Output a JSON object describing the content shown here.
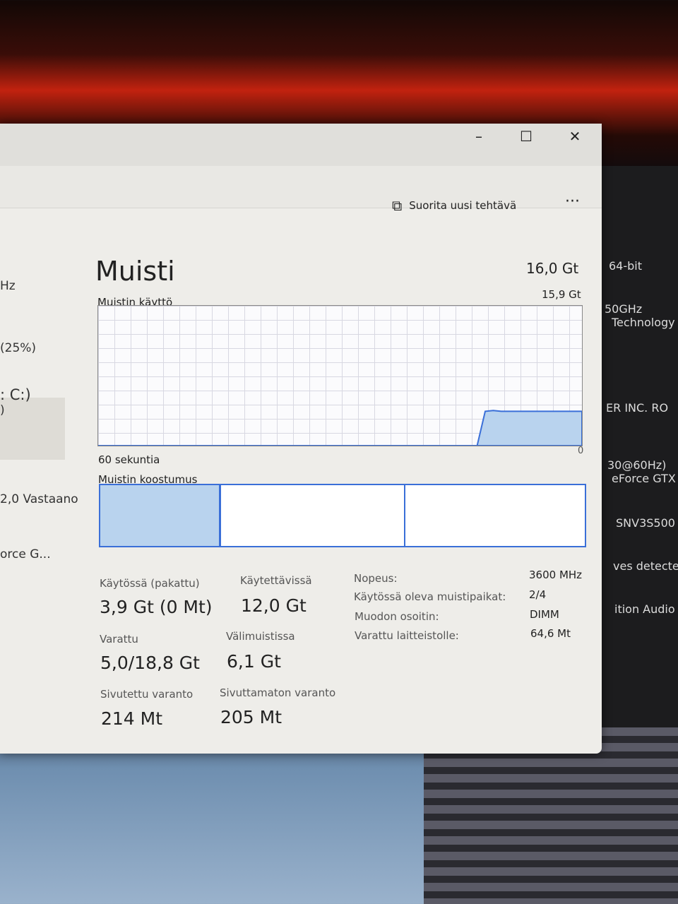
{
  "window": {
    "minimize_icon": "minimize-icon",
    "maximize_icon": "maximize-icon",
    "close_icon": "close-icon"
  },
  "toolbar": {
    "new_task_label": "Suorita uusi tehtävä",
    "more_label": "···"
  },
  "sidebar": {
    "items": [
      "Hz",
      "(25%)",
      ": C:)",
      ")",
      "2,0 Vastaano",
      "orce G..."
    ]
  },
  "right_panel": {
    "items": [
      "64-bit",
      "50GHz",
      "Technology",
      "ER INC. RO",
      "30@60Hz)",
      "eForce GTX",
      "SNV3S500",
      "ves detecte",
      "ition Audio"
    ]
  },
  "memory": {
    "title": "Muisti",
    "total": "16,0 Gt",
    "usage_label": "Muistin käyttö",
    "usage_max": "15,9 Gt",
    "time_label": "60 sekuntia",
    "min_label": "0",
    "composition_label": "Muistin koostumus",
    "composition": {
      "in_use_pct": 24.5,
      "modified_pct": 0.5,
      "standby_pct": 38,
      "free_pct": 37
    },
    "usage_series_gb": [
      0,
      0,
      0,
      0,
      0,
      0,
      0,
      0,
      0,
      0,
      0,
      0,
      0,
      0,
      0,
      0,
      0,
      0,
      0,
      0,
      0,
      0,
      0,
      0,
      0,
      0,
      0,
      0,
      0,
      0,
      0,
      0,
      0,
      0,
      0,
      0,
      0,
      0,
      0,
      0,
      0,
      0,
      0,
      0,
      0,
      0,
      0,
      0,
      3.9,
      4.0,
      3.9,
      3.9,
      3.9,
      3.9,
      3.9,
      3.9,
      3.9,
      3.9,
      3.9,
      3.9,
      3.9
    ],
    "stats": [
      {
        "label": "Käytössä (pakattu)",
        "value": "3,9 Gt (0 Mt)"
      },
      {
        "label": "Käytettävissä",
        "value": "12,0 Gt"
      },
      {
        "label": "Varattu",
        "value": "5,0/18,8 Gt"
      },
      {
        "label": "Välimuistissa",
        "value": "6,1 Gt"
      },
      {
        "label": "Sivutettu varanto",
        "value": "214 Mt"
      },
      {
        "label": "Sivuttamaton varanto",
        "value": "205 Mt"
      }
    ],
    "details": [
      {
        "label": "Nopeus:",
        "value": "3600 MHz"
      },
      {
        "label": "Käytössä oleva muistipaikat:",
        "value": "2/4"
      },
      {
        "label": "Muodon osoitin:",
        "value": "DIMM"
      },
      {
        "label": "Varattu laitteistolle:",
        "value": "64,6 Mt"
      }
    ]
  },
  "colors": {
    "accent": "#3a6fd8",
    "fill": "#b9d3ee"
  }
}
